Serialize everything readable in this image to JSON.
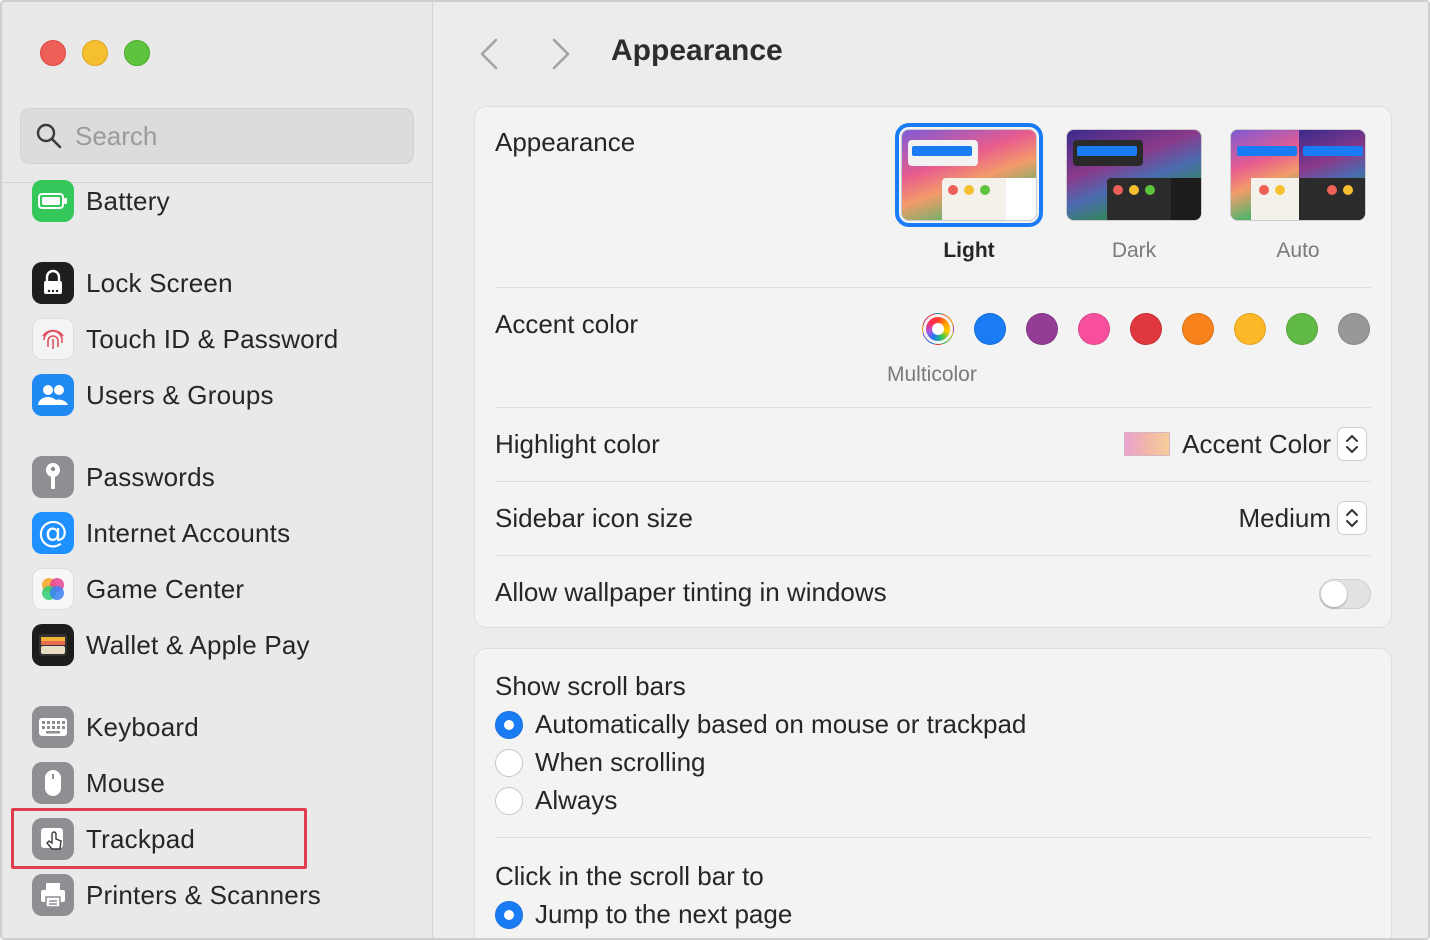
{
  "window": {
    "title": "Appearance",
    "traffic_lights": [
      "close",
      "minimize",
      "zoom"
    ]
  },
  "sidebar": {
    "search": {
      "placeholder": "Search",
      "value": ""
    },
    "items": [
      {
        "label": "Battery",
        "icon": "battery-icon"
      },
      {
        "label": "Lock Screen",
        "icon": "lock-icon"
      },
      {
        "label": "Touch ID & Password",
        "icon": "fingerprint-icon"
      },
      {
        "label": "Users & Groups",
        "icon": "users-icon"
      },
      {
        "label": "Passwords",
        "icon": "key-icon"
      },
      {
        "label": "Internet Accounts",
        "icon": "at-sign-icon"
      },
      {
        "label": "Game Center",
        "icon": "game-center-icon"
      },
      {
        "label": "Wallet & Apple Pay",
        "icon": "wallet-icon"
      },
      {
        "label": "Keyboard",
        "icon": "keyboard-icon"
      },
      {
        "label": "Mouse",
        "icon": "mouse-icon"
      },
      {
        "label": "Trackpad",
        "icon": "trackpad-icon"
      },
      {
        "label": "Printers & Scanners",
        "icon": "printer-icon"
      }
    ],
    "highlighted_item": "Trackpad"
  },
  "main": {
    "title": "Appearance",
    "appearance": {
      "label": "Appearance",
      "options": [
        {
          "label": "Light",
          "selected": true
        },
        {
          "label": "Dark",
          "selected": false
        },
        {
          "label": "Auto",
          "selected": false
        }
      ]
    },
    "accent_color": {
      "label": "Accent color",
      "selected_caption": "Multicolor",
      "swatches": [
        {
          "name": "multicolor",
          "color": "multicolor"
        },
        {
          "name": "blue",
          "color": "#1a7cf5"
        },
        {
          "name": "purple",
          "color": "#953d96"
        },
        {
          "name": "pink",
          "color": "#f74f9e"
        },
        {
          "name": "red",
          "color": "#e0383e"
        },
        {
          "name": "orange",
          "color": "#f7821b"
        },
        {
          "name": "yellow",
          "color": "#fcb827"
        },
        {
          "name": "green",
          "color": "#62ba46"
        },
        {
          "name": "graphite",
          "color": "#989898"
        }
      ]
    },
    "highlight_color": {
      "label": "Highlight color",
      "value": "Accent Color"
    },
    "sidebar_icon_size": {
      "label": "Sidebar icon size",
      "value": "Medium"
    },
    "wallpaper_tinting": {
      "label": "Allow wallpaper tinting in windows",
      "enabled": false
    },
    "scroll_bars": {
      "label": "Show scroll bars",
      "options": [
        {
          "label": "Automatically based on mouse or trackpad",
          "selected": true
        },
        {
          "label": "When scrolling",
          "selected": false
        },
        {
          "label": "Always",
          "selected": false
        }
      ]
    },
    "click_scroll_bar": {
      "label": "Click in the scroll bar to",
      "options": [
        {
          "label": "Jump to the next page",
          "selected": true
        }
      ]
    }
  }
}
